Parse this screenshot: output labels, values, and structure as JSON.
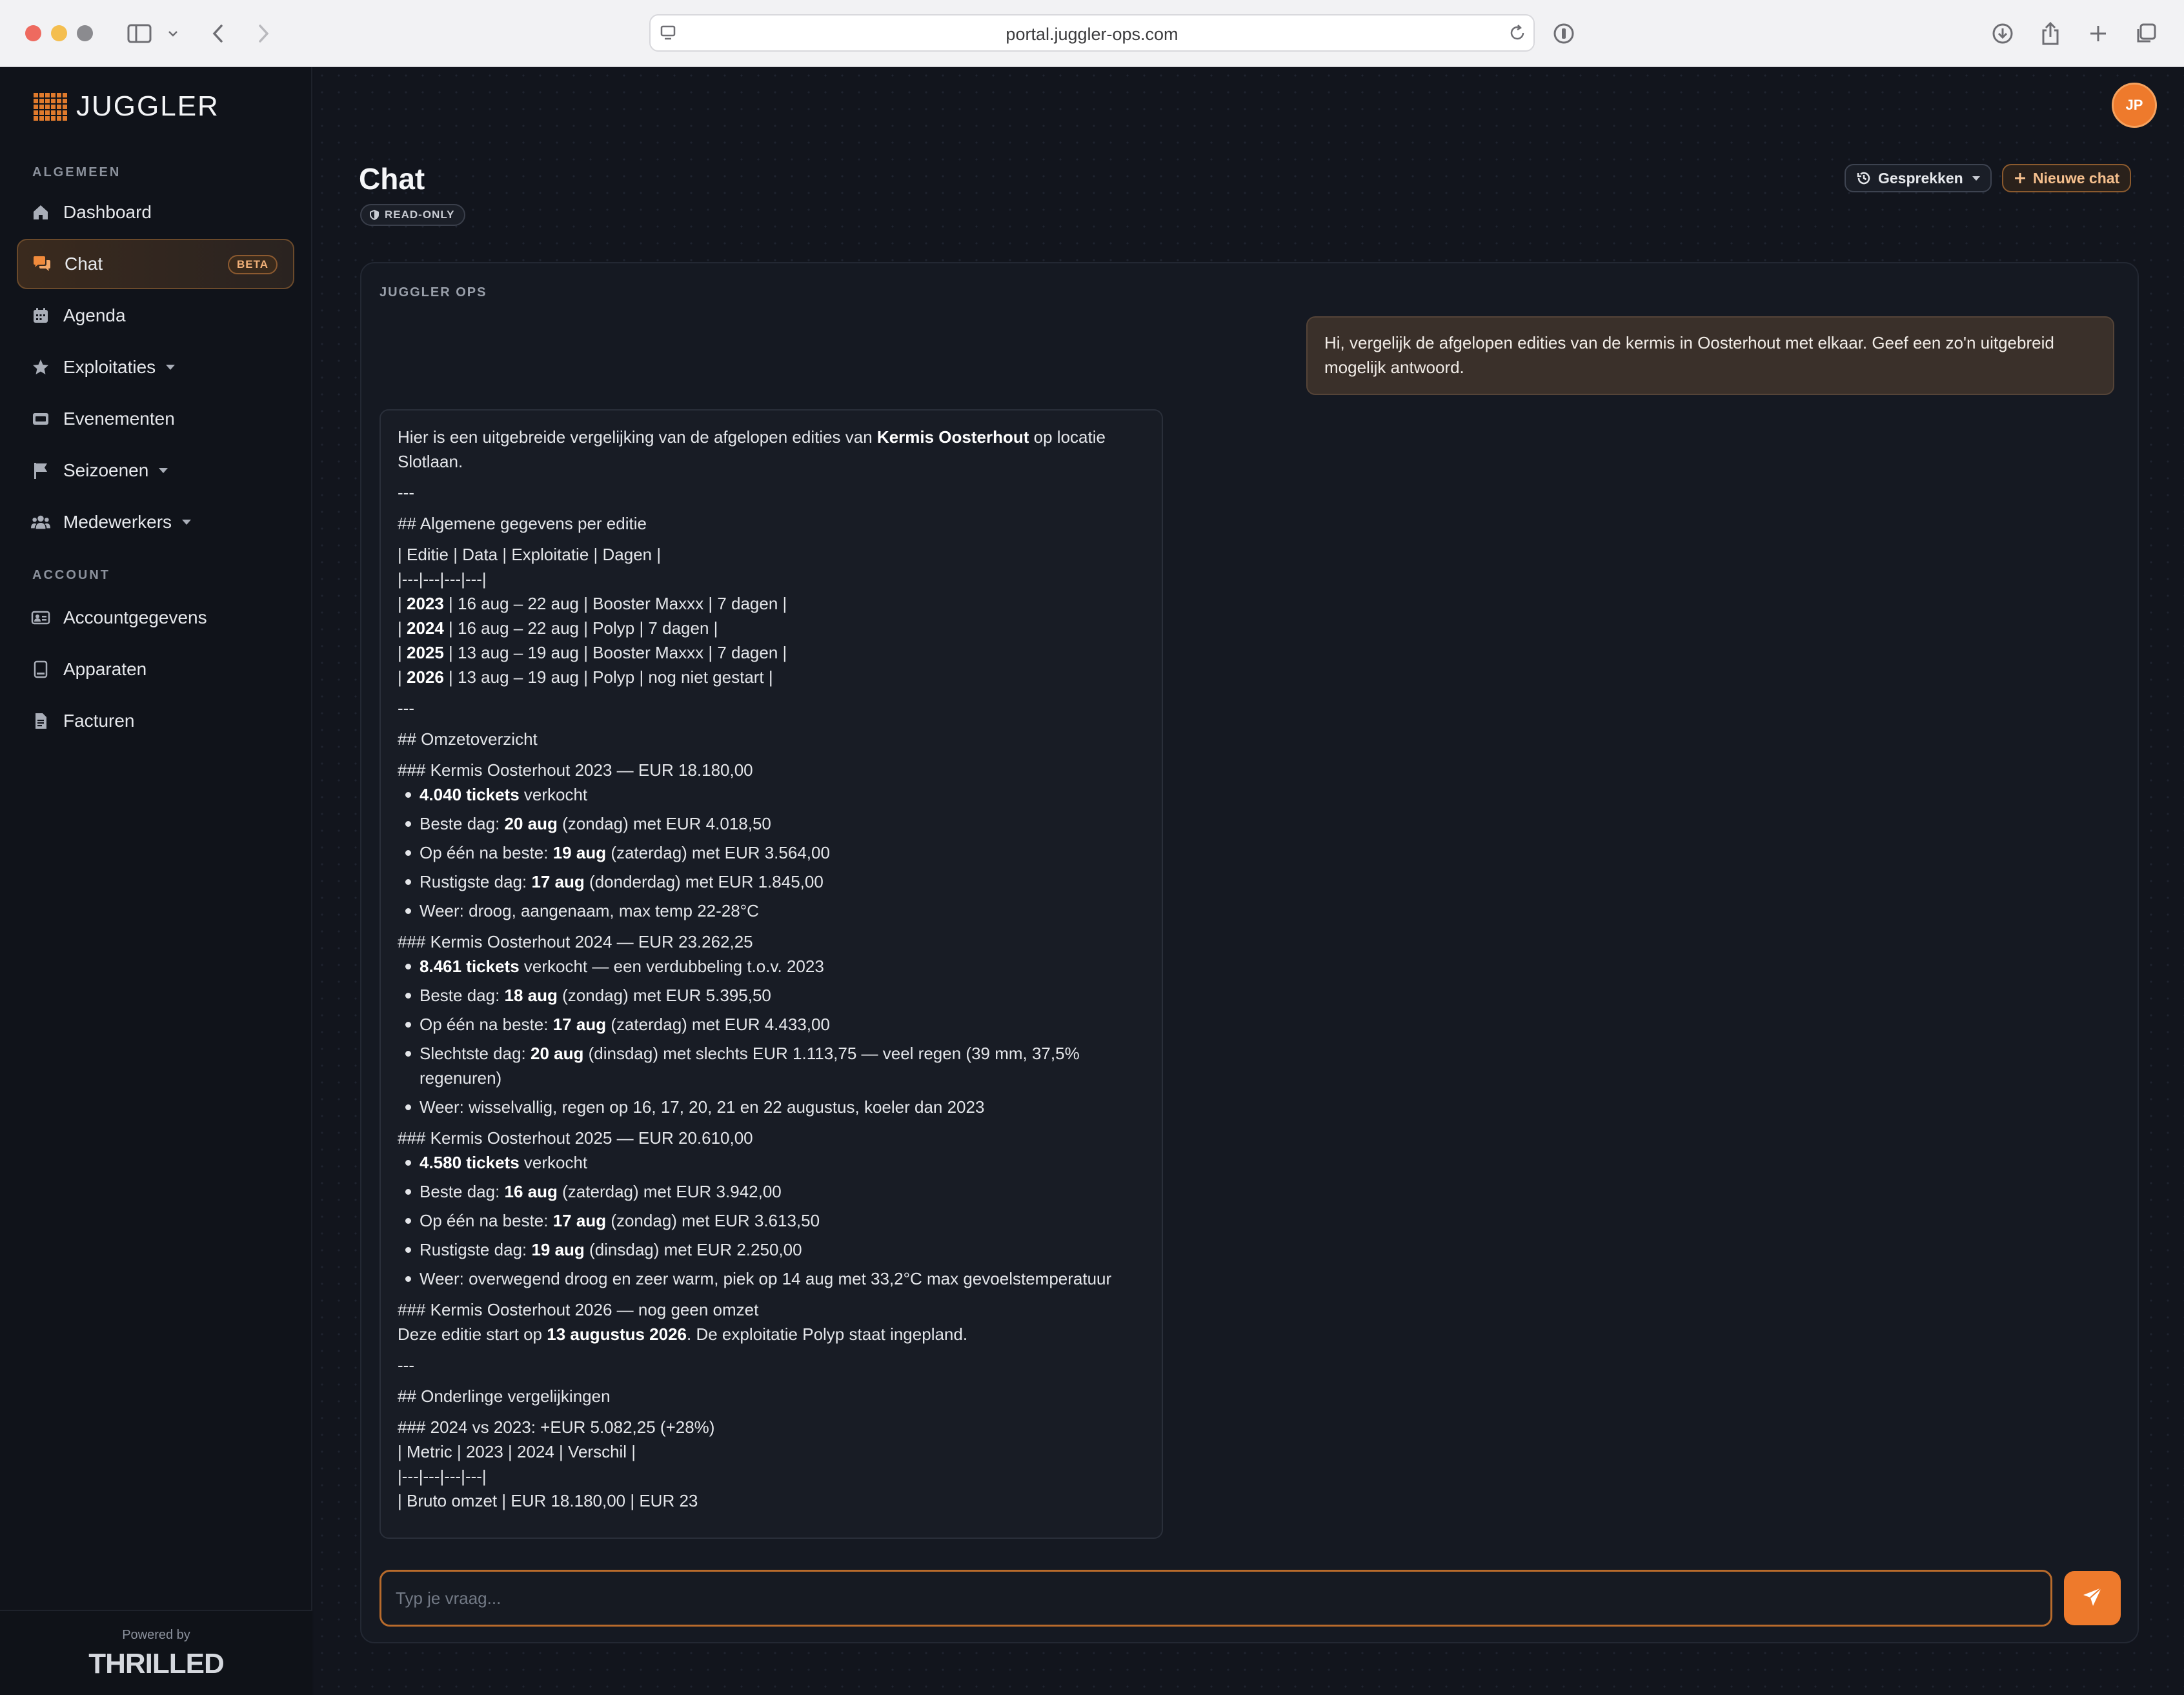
{
  "browser": {
    "url": "portal.juggler-ops.com"
  },
  "brand": {
    "name": "JUGGLER"
  },
  "sidebar": {
    "section_general": "ALGEMEEN",
    "section_account": "ACCOUNT",
    "items": [
      {
        "label": "Dashboard",
        "icon": "home-icon"
      },
      {
        "label": "Chat",
        "icon": "chat-icon",
        "badge": "BETA",
        "active": true
      },
      {
        "label": "Agenda",
        "icon": "calendar-icon"
      },
      {
        "label": "Exploitaties",
        "icon": "star-icon",
        "dropdown": true
      },
      {
        "label": "Evenementen",
        "icon": "ticket-icon"
      },
      {
        "label": "Seizoenen",
        "icon": "flag-icon",
        "dropdown": true
      },
      {
        "label": "Medewerkers",
        "icon": "users-icon",
        "dropdown": true
      }
    ],
    "account_items": [
      {
        "label": "Accountgegevens",
        "icon": "id-card-icon"
      },
      {
        "label": "Apparaten",
        "icon": "tablet-icon"
      },
      {
        "label": "Facturen",
        "icon": "invoice-icon"
      }
    ],
    "powered_by": "Powered by",
    "powered_logo": "THRILLED"
  },
  "header": {
    "avatar_initials": "JP",
    "title": "Chat",
    "readonly_badge": "READ-ONLY",
    "history_button": "Gesprekken",
    "new_chat_button": "Nieuwe chat"
  },
  "chat": {
    "section_label": "JUGGLER OPS",
    "user_message": "Hi, vergelijk de afgelopen edities van de kermis in Oosterhout met elkaar. Geef een zo'n uitgebreid mogelijk antwoord.",
    "input_placeholder": "Typ je vraag...",
    "response": {
      "intro_a": "Hier is een uitgebreide vergelijking van de afgelopen edities van ",
      "intro_b": "Kermis Oosterhout",
      "intro_c": " op locatie Slotlaan.",
      "sep": "---",
      "h_general": "## Algemene gegevens per editie",
      "table_head": "| Editie | Data | Exploitatie | Dagen |",
      "table_sep": "|---|---|---|---|",
      "rows": [
        {
          "year": "2023",
          "rest": " | 16 aug – 22 aug | Booster Maxxx | 7 dagen |"
        },
        {
          "year": "2024",
          "rest": " | 16 aug – 22 aug | Polyp | 7 dagen |"
        },
        {
          "year": "2025",
          "rest": " | 13 aug – 19 aug | Booster Maxxx | 7 dagen |"
        },
        {
          "year": "2026",
          "rest": " | 13 aug – 19 aug | Polyp | nog niet gestart |"
        }
      ],
      "h_revenue": "## Omzetoverzicht",
      "h_2023": "### Kermis Oosterhout 2023 — EUR 18.180,00",
      "b2023_1a": "4.040 tickets",
      "b2023_1b": " verkocht",
      "b2023_2a": "Beste dag: ",
      "b2023_2b": "20 aug",
      "b2023_2c": " (zondag) met EUR 4.018,50",
      "b2023_3a": "Op één na beste: ",
      "b2023_3b": "19 aug",
      "b2023_3c": " (zaterdag) met EUR 3.564,00",
      "b2023_4a": "Rustigste dag: ",
      "b2023_4b": "17 aug",
      "b2023_4c": " (donderdag) met EUR 1.845,00",
      "b2023_5": "Weer: droog, aangenaam, max temp 22-28°C",
      "h_2024": "### Kermis Oosterhout 2024 — EUR 23.262,25",
      "b2024_1a": "8.461 tickets",
      "b2024_1b": " verkocht — een verdubbeling t.o.v. 2023",
      "b2024_2a": "Beste dag: ",
      "b2024_2b": "18 aug",
      "b2024_2c": " (zondag) met EUR 5.395,50",
      "b2024_3a": "Op één na beste: ",
      "b2024_3b": "17 aug",
      "b2024_3c": " (zaterdag) met EUR 4.433,00",
      "b2024_4a": "Slechtste dag: ",
      "b2024_4b": "20 aug",
      "b2024_4c": " (dinsdag) met slechts EUR 1.113,75 — veel regen (39 mm, 37,5% regenuren)",
      "b2024_5": "Weer: wisselvallig, regen op 16, 17, 20, 21 en 22 augustus, koeler dan 2023",
      "h_2025": "### Kermis Oosterhout 2025 — EUR 20.610,00",
      "b2025_1a": "4.580 tickets",
      "b2025_1b": " verkocht",
      "b2025_2a": "Beste dag: ",
      "b2025_2b": "16 aug",
      "b2025_2c": " (zaterdag) met EUR 3.942,00",
      "b2025_3a": "Op één na beste: ",
      "b2025_3b": "17 aug",
      "b2025_3c": " (zondag) met EUR 3.613,50",
      "b2025_4a": "Rustigste dag: ",
      "b2025_4b": "19 aug",
      "b2025_4c": " (dinsdag) met EUR 2.250,00",
      "b2025_5": "Weer: overwegend droog en zeer warm, piek op 14 aug met 33,2°C max gevoelstemperatuur",
      "h_2026": "### Kermis Oosterhout 2026 — nog geen omzet",
      "p2026_a": "Deze editie start op ",
      "p2026_b": "13 augustus 2026",
      "p2026_c": ". De exploitatie Polyp staat ingepland.",
      "h_compare": "## Onderlinge vergelijkingen",
      "h_2024vs2023": "### 2024 vs 2023: +EUR 5.082,25 (+28%)",
      "cmp_head": "| Metric | 2023 | 2024 | Verschil |",
      "cmp_sep": "|---|---|---|---|",
      "cmp_row1": "| Bruto omzet | EUR 18.180,00 | EUR 23"
    }
  },
  "colors": {
    "accent": "#ee7a2c",
    "background": "#12151d",
    "sidebar": "#10131a"
  }
}
